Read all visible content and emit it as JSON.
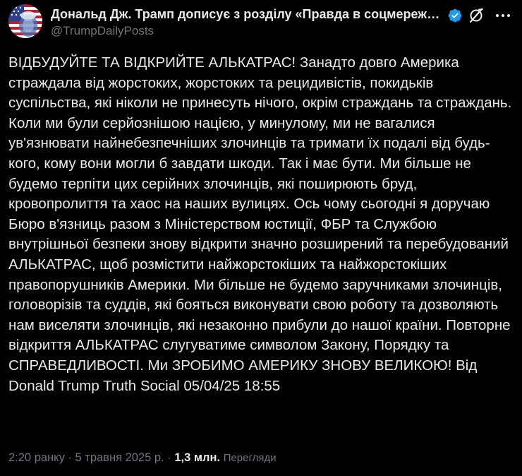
{
  "post": {
    "author": {
      "display_name": "Дональд Дж. Трамп дописує з розділу «Правда в соцмережах»",
      "handle": "@TrumpDailyPosts",
      "verified": true,
      "avatar_icon": "flag-portrait-avatar"
    },
    "text": "ВІДБУДУЙТЕ ТА ВІДКРИЙТЕ АЛЬКАТРАС! Занадто довго Америка страждала від жорстоких, жорстоких та рецидивістів, покидьків суспільства, які ніколи не принесуть нічого, окрім страждань та страждань. Коли ми були серйознішою нацією, у минулому, ми не вагалися ув'язнювати найнебезпечніших злочинців та тримати їх подалі від будь-кого, кому вони могли б завдати шкоди. Так і має бути. Ми більше не будемо терпіти цих серійних злочинців, які поширюють бруд, кровопролиття та хаос на наших вулицях. Ось чому сьогодні я доручаю Бюро в'язниць разом з Міністерством юстиції, ФБР та Службою внутрішньої безпеки знову відкрити значно розширений та перебудований АЛЬКАТРАС, щоб розмістити найжорстокіших та найжорстокіших правопорушників Америки. Ми більше не будемо заручниками злочинців, головорізів та суддів, які бояться виконувати свою роботу та дозволяють нам виселяти злочинців, які незаконно прибули до нашої країни. Повторне відкриття АЛЬКАТРАС слугуватиме символом Закону, Порядку та СПРАВЕДЛИВОСТІ. Ми ЗРОБИМО АМЕРИКУ ЗНОВУ ВЕЛИКОЮ! Від Donald Trump Truth Social 05/04/25 18:55",
    "meta": {
      "time": "2:20 ранку",
      "separator": "·",
      "date": "5 травня 2025 р.",
      "views_count": "1,3 млн.",
      "views_label": "Перегляди"
    }
  },
  "colors": {
    "background": "#000000",
    "text_primary": "#e7e9ea",
    "text_secondary": "#71767b",
    "verified_badge": "#1d9bf0"
  },
  "icons": {
    "verified": "verified-badge-icon",
    "grok": "grok-icon",
    "more": "more-options-icon"
  }
}
